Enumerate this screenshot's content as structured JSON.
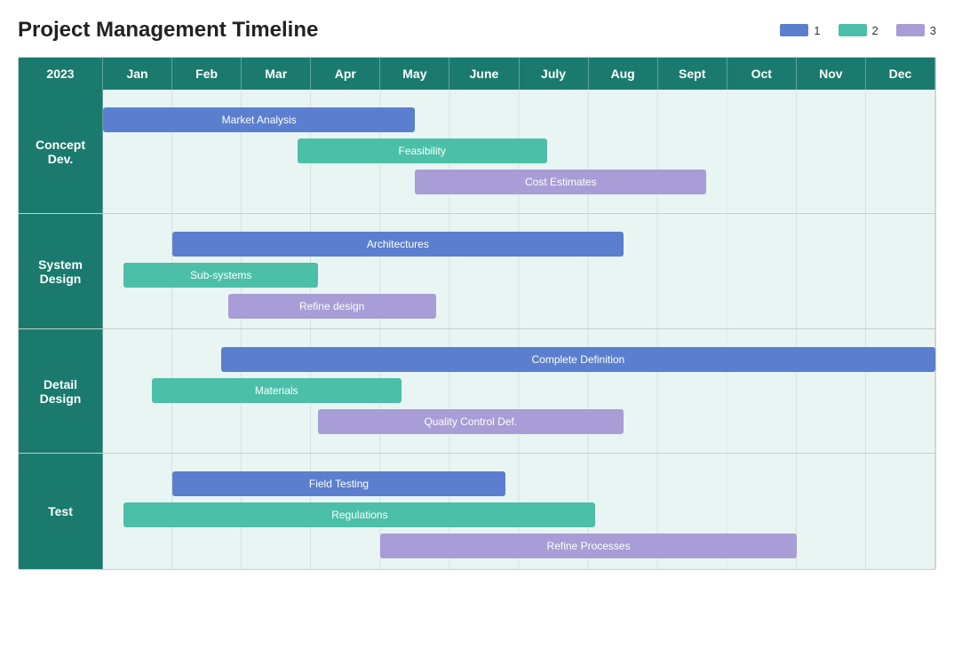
{
  "title": "Project Management Timeline",
  "legend": {
    "items": [
      {
        "id": "1",
        "label": "1",
        "color": "#5b7fce"
      },
      {
        "id": "2",
        "label": "2",
        "color": "#4cbfa8"
      },
      {
        "id": "3",
        "label": "3",
        "color": "#a89dd6"
      }
    ]
  },
  "header": {
    "year": "2023",
    "months": [
      "Jan",
      "Feb",
      "Mar",
      "Apr",
      "May",
      "June",
      "July",
      "Aug",
      "Sept",
      "Oct",
      "Nov",
      "Dec"
    ]
  },
  "rows": [
    {
      "id": "concept-dev",
      "label": "Concept Dev.",
      "bars": [
        {
          "id": "market-analysis",
          "label": "Market Analysis",
          "type": "blue",
          "start": 0.0,
          "width": 4.5
        },
        {
          "id": "feasibility",
          "label": "Feasibility",
          "type": "green",
          "start": 2.8,
          "width": 3.6
        },
        {
          "id": "cost-estimates",
          "label": "Cost Estimates",
          "type": "purple",
          "start": 4.5,
          "width": 4.2
        }
      ]
    },
    {
      "id": "system-design",
      "label": "System Design",
      "bars": [
        {
          "id": "architectures",
          "label": "Architectures",
          "type": "blue",
          "start": 1.0,
          "width": 6.5
        },
        {
          "id": "sub-systems",
          "label": "Sub-systems",
          "type": "green",
          "start": 0.3,
          "width": 2.8
        },
        {
          "id": "refine-design",
          "label": "Refine design",
          "type": "purple",
          "start": 1.8,
          "width": 3.0
        }
      ]
    },
    {
      "id": "detail-design",
      "label": "Detail Design",
      "bars": [
        {
          "id": "complete-definition",
          "label": "Complete Definition",
          "type": "blue",
          "start": 1.7,
          "width": 10.3
        },
        {
          "id": "materials",
          "label": "Materials",
          "type": "green",
          "start": 0.7,
          "width": 3.6
        },
        {
          "id": "quality-control",
          "label": "Quality Control Def.",
          "type": "purple",
          "start": 3.1,
          "width": 4.4
        }
      ]
    },
    {
      "id": "test",
      "label": "Test",
      "bars": [
        {
          "id": "field-testing",
          "label": "Field Testing",
          "type": "blue",
          "start": 1.0,
          "width": 4.8
        },
        {
          "id": "regulations",
          "label": "Regulations",
          "type": "green",
          "start": 0.3,
          "width": 6.8
        },
        {
          "id": "refine-processes",
          "label": "Refine Processes",
          "type": "purple",
          "start": 4.0,
          "width": 6.0
        }
      ]
    }
  ],
  "colors": {
    "header_bg": "#1a7a6e",
    "row_bg": "#e8f5f3",
    "blue": "#5b7fce",
    "green": "#4cbfa8",
    "purple": "#a89dd6"
  }
}
